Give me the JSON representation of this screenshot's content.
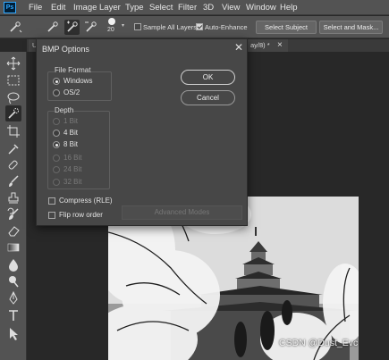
{
  "app": {
    "logo_text": "Ps"
  },
  "menus": [
    "File",
    "Edit",
    "Image",
    "Layer",
    "Type",
    "Select",
    "Filter",
    "3D",
    "View",
    "Window",
    "Help"
  ],
  "options_bar": {
    "brush_size": "20",
    "sample_all_layers": {
      "label": "Sample All Layers",
      "checked": false
    },
    "auto_enhance": {
      "label": "Auto-Enhance",
      "checked": true
    },
    "select_subject_label": "Select Subject",
    "select_and_mask_label": "Select and Mask..."
  },
  "document_tab": {
    "title_left": "Ui",
    "title_right": "ay/8) *",
    "close": "×"
  },
  "dialog": {
    "title": "BMP Options",
    "close_glyph": "✕",
    "file_format": {
      "label": "File Format",
      "options": [
        {
          "label": "Windows",
          "selected": true
        },
        {
          "label": "OS/2",
          "selected": false
        }
      ]
    },
    "depth": {
      "label": "Depth",
      "options": [
        {
          "label": "1 Bit",
          "selected": false,
          "enabled": false
        },
        {
          "label": "4 Bit",
          "selected": false,
          "enabled": true
        },
        {
          "label": "8 Bit",
          "selected": true,
          "enabled": true
        },
        {
          "label": "16 Bit",
          "selected": false,
          "enabled": false
        },
        {
          "label": "24 Bit",
          "selected": false,
          "enabled": false
        },
        {
          "label": "32 Bit",
          "selected": false,
          "enabled": false
        }
      ]
    },
    "compress": {
      "label": "Compress (RLE)",
      "checked": false
    },
    "flip_row_order": {
      "label": "Flip row order",
      "checked": false
    },
    "ok_label": "OK",
    "cancel_label": "Cancel",
    "advanced_modes_label": "Advanced Modes"
  },
  "tools": [
    "move-icon",
    "marquee-icon",
    "lasso-icon",
    "quick-select-icon",
    "crop-icon",
    "eyedropper-icon",
    "healing-icon",
    "brush-icon",
    "clone-stamp-icon",
    "history-brush-icon",
    "eraser-icon",
    "gradient-icon",
    "blur-icon",
    "dodge-icon",
    "pen-icon",
    "type-icon",
    "path-select-icon"
  ],
  "watermark": "CSDN @Dust_Evc"
}
